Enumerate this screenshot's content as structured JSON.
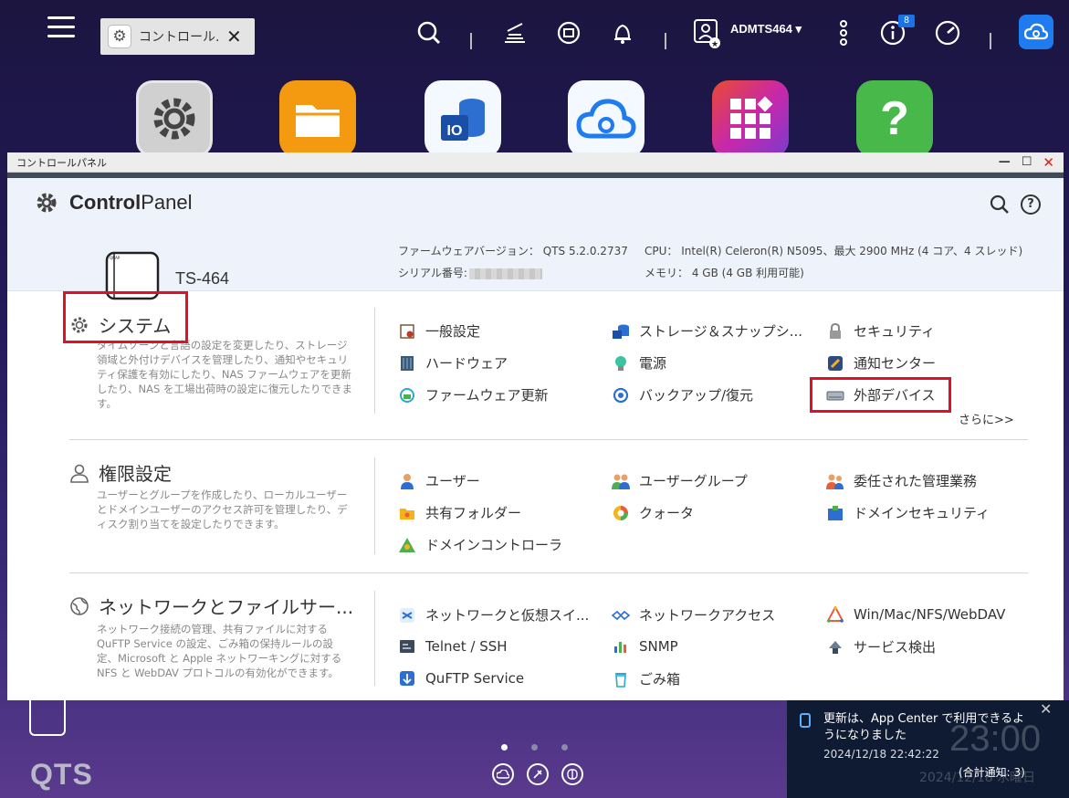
{
  "taskbar": {
    "tab_label": "コントロール...",
    "user": "ADMTS464 ▾",
    "notification_badge": "8"
  },
  "window": {
    "title": "コントロールパネル",
    "logo_bold": "Control",
    "logo_rest": "Panel"
  },
  "device": {
    "model": "TS-464",
    "firmware_label": "ファームウェアバージョン：",
    "firmware_value": "QTS 5.2.0.2737",
    "serial_label": "シリアル番号:",
    "cpu_label": "CPU：",
    "cpu_value": "Intel(R) Celeron(R) N5095、最大 2900 MHz (4 コア、4 スレッド)",
    "memory_label": "メモリ：",
    "memory_value": "4 GB (4 GB 利用可能)"
  },
  "sections": [
    {
      "title": "システム",
      "description": "タイムゾーンと言語の設定を変更したり、ストレージ領域と外付けデバイスを管理したり、通知やセキュリティ保護を有効にしたり、NAS ファームウェアを更新したり、NAS を工場出荷時の設定に復元したりできます。",
      "items": [
        "一般設定",
        "ストレージ＆スナップシ...",
        "セキュリティ",
        "ハードウェア",
        "電源",
        "通知センター",
        "ファームウェア更新",
        "バックアップ/復元",
        "外部デバイス"
      ],
      "more": "さらに>>"
    },
    {
      "title": "権限設定",
      "description": "ユーザーとグループを作成したり、ローカルユーザーとドメインユーザーのアクセス許可を管理したり、ディスク割り当てを設定したりできます。",
      "items": [
        "ユーザー",
        "ユーザーグループ",
        "委任された管理業務",
        "共有フォルダー",
        "クォータ",
        "ドメインセキュリティ",
        "ドメインコントローラ"
      ]
    },
    {
      "title": "ネットワークとファイルサー...",
      "description": "ネットワーク接続の管理、共有ファイルに対する QuFTP Service の設定、ごみ箱の保持ルールの設定、Microsoft と Apple ネットワーキングに対する NFS と WebDAV プロトコルの有効化ができます。",
      "items": [
        "ネットワークと仮想スイ...",
        "ネットワークアクセス",
        "Win/Mac/NFS/WebDAV",
        "Telnet / SSH",
        "SNMP",
        "サービス検出",
        "QuFTP Service",
        "ごみ箱"
      ]
    }
  ],
  "desktop": {
    "logo": "QTS"
  },
  "notification": {
    "message": "更新は、App Center で利用できるようになりました",
    "time": "2024/12/18 22:42:22",
    "total": "(合計通知: 3)",
    "clock": "23:00",
    "date": "2024/12/18 水曜日"
  },
  "colors": {
    "highlight_box": "#e0102a",
    "accent_blue": "#1e7bf0"
  }
}
